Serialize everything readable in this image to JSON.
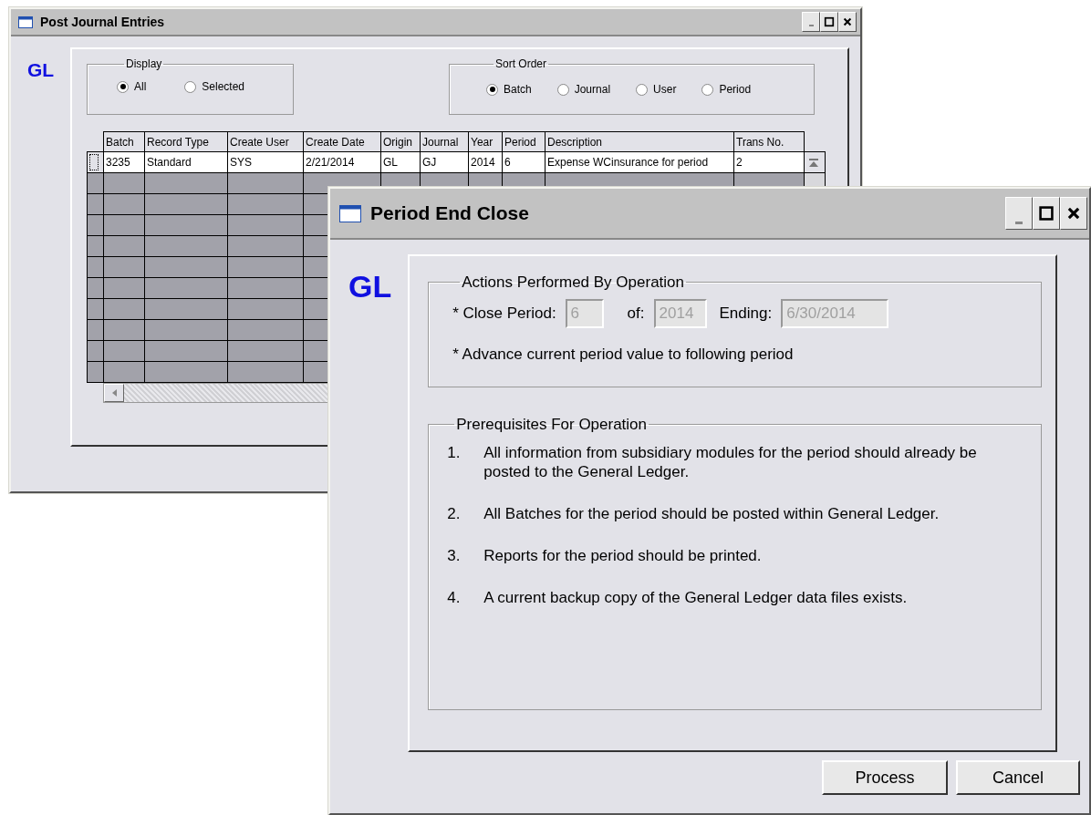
{
  "journal_window": {
    "title": "Post Journal Entries",
    "logo": "GL",
    "display": {
      "label": "Display",
      "options": [
        {
          "label": "All",
          "selected": true
        },
        {
          "label": "Selected",
          "selected": false
        }
      ]
    },
    "sort_order": {
      "label": "Sort Order",
      "options": [
        {
          "label": "Batch",
          "selected": true
        },
        {
          "label": "Journal",
          "selected": false
        },
        {
          "label": "User",
          "selected": false
        },
        {
          "label": "Period",
          "selected": false
        }
      ]
    },
    "table": {
      "columns": [
        "Batch",
        "Record Type",
        "Create User",
        "Create Date",
        "Origin",
        "Journal",
        "Year",
        "Period",
        "Description",
        "Trans No."
      ],
      "rows": [
        {
          "cells": [
            "3235",
            "Standard",
            "SYS",
            "2/21/2014",
            "GL",
            "GJ",
            "2014",
            "6",
            "Expense WCinsurance for period",
            "2"
          ]
        }
      ]
    }
  },
  "close_window": {
    "title": "Period End Close",
    "logo": "GL",
    "actions": {
      "label": "Actions Performed By Operation",
      "fields": [
        {
          "label": "* Close Period:",
          "value": "6",
          "disabled": true
        },
        {
          "label": "of:",
          "value": "2014",
          "disabled": true
        },
        {
          "label": "Ending:",
          "value": "6/30/2014",
          "disabled": true
        }
      ],
      "note": "* Advance current period value to following period"
    },
    "prerequisites": {
      "label": "Prerequisites For Operation",
      "items": [
        {
          "number": "1.",
          "text": "All information from subsidiary modules for the period should already be posted to the General Ledger."
        },
        {
          "number": "2.",
          "text": "All Batches for the period should be posted within General Ledger."
        },
        {
          "number": "3.",
          "text": "Reports for the period should be printed."
        },
        {
          "number": "4.",
          "text": "A current backup copy of the General Ledger data files exists."
        }
      ]
    },
    "buttons": [
      "Process",
      "Cancel"
    ]
  }
}
